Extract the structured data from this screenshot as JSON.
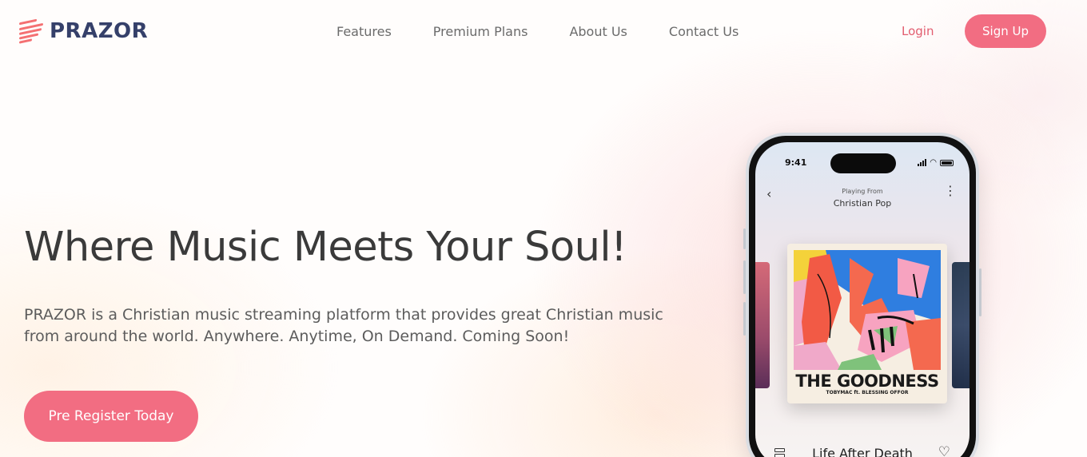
{
  "brand": {
    "name": "PRAZOR",
    "accent": "#f26d82",
    "logo_color": "#35406a"
  },
  "nav": {
    "items": [
      {
        "label": "Features"
      },
      {
        "label": "Premium Plans"
      },
      {
        "label": "About Us"
      },
      {
        "label": "Contact Us"
      }
    ],
    "login_label": "Login",
    "signup_label": "Sign Up"
  },
  "hero": {
    "headline": "Where Music Meets Your Soul!",
    "description": "PRAZOR is a Christian music streaming platform that provides great Christian music from around the world. Anywhere. Anytime, On Demand. Coming Soon!",
    "cta_label": "Pre Register Today"
  },
  "phone": {
    "time": "9:41",
    "playing_from_label": "Playing From",
    "playlist": "Christian Pop",
    "album_title": "THE GOODNESS",
    "album_artist": "TOBYMAC ft. BLESSING OFFOR",
    "track_title": "Life After Death",
    "icons": [
      "back-chevron-icon",
      "more-vertical-icon",
      "queue-icon",
      "heart-icon",
      "signal-icon",
      "wifi-icon",
      "battery-icon"
    ]
  }
}
